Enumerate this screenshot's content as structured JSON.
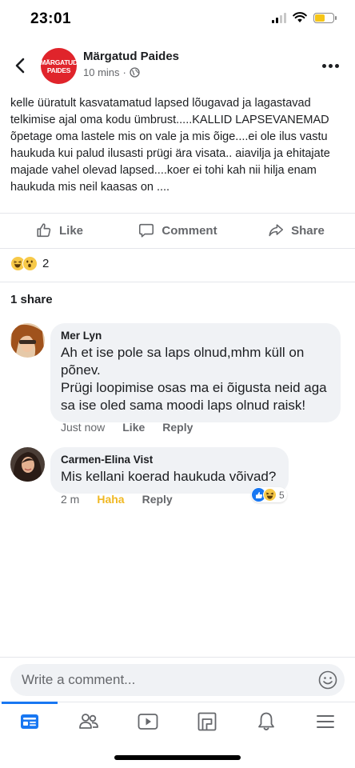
{
  "status_bar": {
    "time": "23:01"
  },
  "post": {
    "page_name": "Märgatud Paides",
    "avatar_line1": "MÄRGATUD",
    "avatar_line2": "PAIDES",
    "timestamp": "10 mins",
    "body": "kelle  üüratult kasvatamatud lapsed lõugavad  ja lagastavad telkimise ajal  oma kodu ümbrust.....KALLID LAPSEVANEMAD  õpetage oma lastele mis on vale ja mis õige....ei ole ilus vastu haukuda kui palud ilusasti prügi ära visata.. aiavilja ja ehitajate majade vahel olevad lapsed....koer ei tohi kah nii hilja enam haukuda mis neil kaasas on ...."
  },
  "actions": {
    "like": "Like",
    "comment": "Comment",
    "share": "Share"
  },
  "reactions": {
    "count": "2"
  },
  "shares": "1 share",
  "comments": [
    {
      "author": "Mer Lyn",
      "text": "Ah et ise pole sa laps olnud,mhm küll on põnev.\nPrügi loopimise osas ma ei õigusta neid aga sa ise oled sama moodi laps olnud raisk!",
      "time": "Just now",
      "like": "Like",
      "reply": "Reply"
    },
    {
      "author": "Carmen-Elina Vist",
      "text": "Mis kellani koerad haukuda võivad?",
      "time": "2 m",
      "like": "Haha",
      "reply": "Reply",
      "reaction_count": "5"
    }
  ],
  "composer": {
    "placeholder": "Write a comment..."
  },
  "colors": {
    "accent": "#1877f2",
    "haha": "#f0b823",
    "page_red": "#e0242b"
  }
}
